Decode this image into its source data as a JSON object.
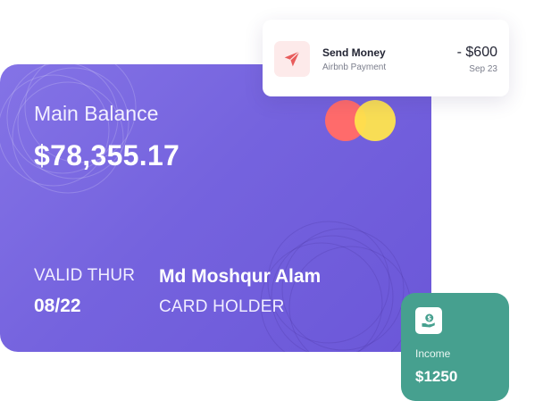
{
  "card": {
    "balance_label": "Main Balance",
    "balance_amount": "$78,355.17",
    "valid_label": "VALID THUR",
    "valid_value": "08/22",
    "holder_name": "Md Moshqur Alam",
    "holder_label": "CARD HOLDER",
    "brand_logo": "mastercard-logo",
    "colors": {
      "gradient_start": "#8473e6",
      "gradient_end": "#6b57d8"
    }
  },
  "transaction": {
    "title": "Send Money",
    "subtitle": "Airbnb Payment",
    "amount": "- $600",
    "date": "Sep 23",
    "icon": "paper-plane-icon",
    "accent": "#e85c5c"
  },
  "income": {
    "label": "Income",
    "amount": "$1250",
    "icon": "money-hand-icon",
    "color": "#46a08f"
  }
}
